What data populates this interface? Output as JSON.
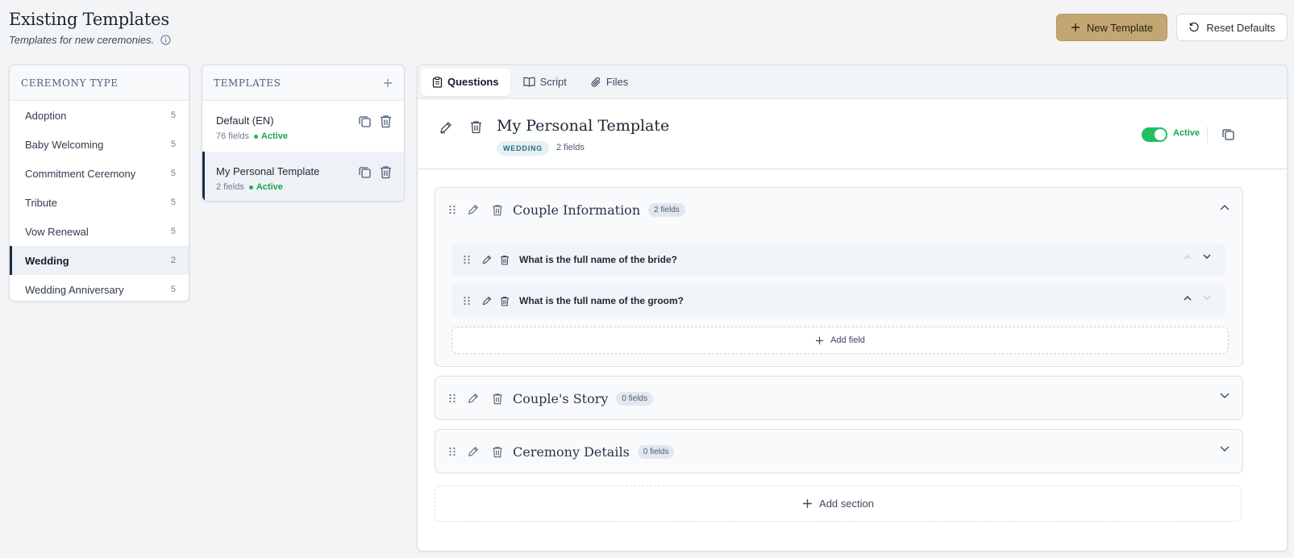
{
  "header": {
    "title": "Existing Templates",
    "subtitle": "Templates for new ceremonies.",
    "new_template_label": "New Template",
    "reset_label": "Reset Defaults"
  },
  "ceremony_panel": {
    "title": "CEREMONY TYPE",
    "items": [
      {
        "label": "Adoption",
        "count": "5"
      },
      {
        "label": "Baby Welcoming",
        "count": "5"
      },
      {
        "label": "Commitment Ceremony",
        "count": "5"
      },
      {
        "label": "Tribute",
        "count": "5"
      },
      {
        "label": "Vow Renewal",
        "count": "5"
      },
      {
        "label": "Wedding",
        "count": "2"
      },
      {
        "label": "Wedding Anniversary",
        "count": "5"
      }
    ],
    "selected": "Wedding"
  },
  "templates_panel": {
    "title": "TEMPLATES",
    "items": [
      {
        "name": "Default (EN)",
        "fields": "76 fields",
        "status": "Active"
      },
      {
        "name": "My Personal Template",
        "fields": "2 fields",
        "status": "Active"
      }
    ]
  },
  "tabs": [
    {
      "label": "Questions",
      "icon": "clipboard-icon"
    },
    {
      "label": "Script",
      "icon": "book-icon"
    },
    {
      "label": "Files",
      "icon": "paperclip-icon"
    }
  ],
  "editor": {
    "title": "My Personal Template",
    "type_badge": "WEDDING",
    "fields": "2 fields",
    "status": "Active",
    "sections": [
      {
        "title": "Couple Information",
        "badge": "2 fields",
        "questions": [
          "What is the full name of the bride?",
          "What is the full name of the groom?"
        ],
        "add_field_label": "Add field"
      },
      {
        "title": "Couple's Story",
        "badge": "0 fields"
      },
      {
        "title": "Ceremony Details",
        "badge": "0 fields"
      }
    ],
    "add_section_label": "Add section"
  },
  "colors": {
    "accent": "#c3a772",
    "active_green": "#1fc160",
    "selected_bar": "#1d2c45"
  }
}
